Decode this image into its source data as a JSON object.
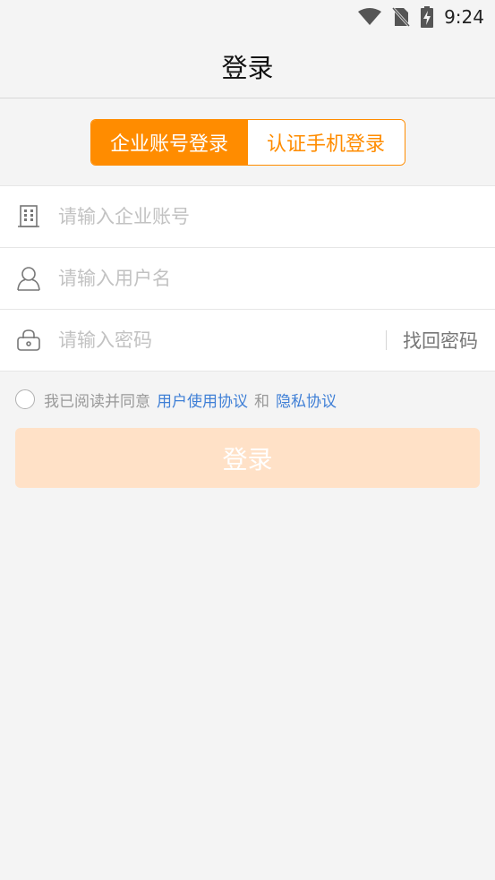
{
  "status_bar": {
    "time": "9:24",
    "icons": [
      "wifi-icon",
      "no-sim-icon",
      "battery-charging-icon"
    ]
  },
  "header": {
    "title": "登录"
  },
  "login_tabs": [
    {
      "label": "企业账号登录",
      "active": true
    },
    {
      "label": "认证手机登录",
      "active": false
    }
  ],
  "form": {
    "company_account": {
      "placeholder": "请输入企业账号",
      "value": "",
      "icon": "building-icon"
    },
    "username": {
      "placeholder": "请输入用户名",
      "value": "",
      "icon": "user-icon"
    },
    "password": {
      "placeholder": "请输入密码",
      "value": "",
      "icon": "lock-icon"
    },
    "find_password_label": "找回密码"
  },
  "agreement": {
    "checked": false,
    "prefix": "我已阅读并同意",
    "user_agreement": "用户使用协议",
    "and": "和",
    "privacy_policy": "隐私协议"
  },
  "login_button": {
    "label": "登录"
  },
  "colors": {
    "accent": "#ff8c00",
    "link": "#3f7fd6",
    "button_disabled": "#ffe1c7",
    "background": "#f4f4f4"
  }
}
